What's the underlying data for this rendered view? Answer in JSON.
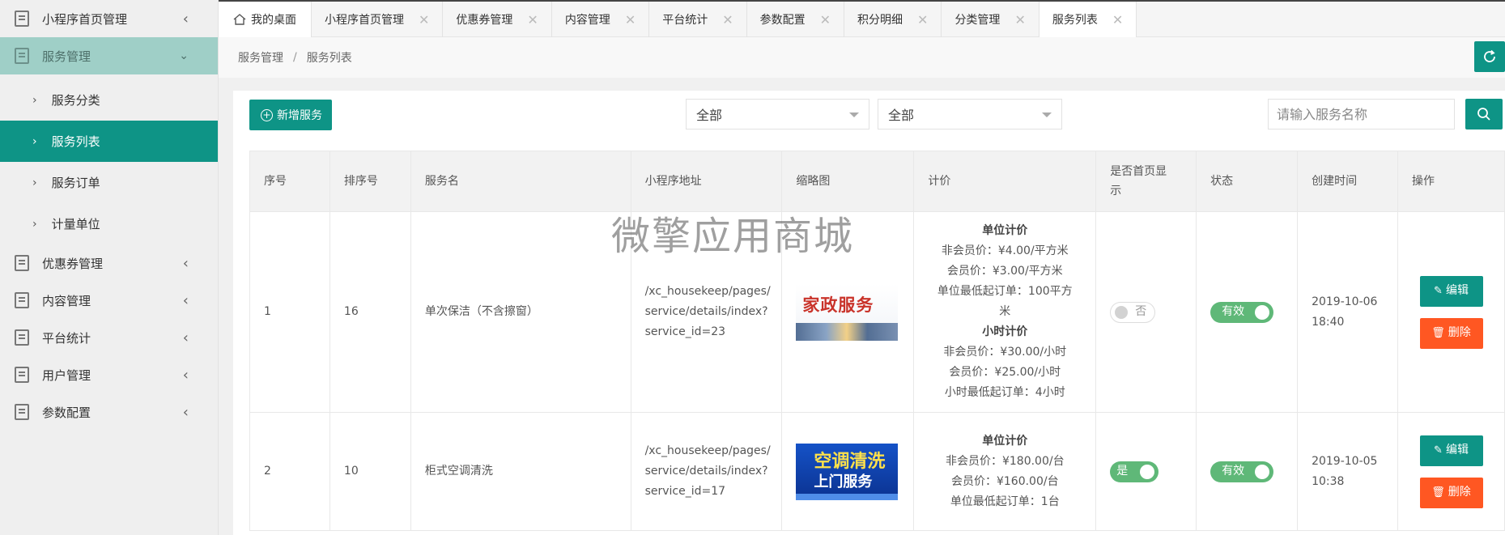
{
  "sidebar": {
    "items": [
      {
        "label": "小程序首页管理",
        "expanded": false
      },
      {
        "label": "服务管理",
        "expanded": true,
        "children": [
          {
            "label": "服务分类"
          },
          {
            "label": "服务列表",
            "active": true
          },
          {
            "label": "服务订单"
          },
          {
            "label": "计量单位"
          }
        ]
      },
      {
        "label": "优惠券管理",
        "expanded": false
      },
      {
        "label": "内容管理",
        "expanded": false
      },
      {
        "label": "平台统计",
        "expanded": false
      },
      {
        "label": "用户管理",
        "expanded": false
      },
      {
        "label": "参数配置",
        "expanded": false
      }
    ]
  },
  "tabs": [
    {
      "label": "我的桌面",
      "home": true
    },
    {
      "label": "小程序首页管理",
      "close": "✕"
    },
    {
      "label": "优惠券管理",
      "close": "✕"
    },
    {
      "label": "内容管理",
      "close": "✕"
    },
    {
      "label": "平台统计",
      "close": "✕"
    },
    {
      "label": "参数配置",
      "close": "✕"
    },
    {
      "label": "积分明细",
      "close": "✕"
    },
    {
      "label": "分类管理",
      "close": "✕"
    },
    {
      "label": "服务列表",
      "close": "✕",
      "active": true
    }
  ],
  "breadcrumb": {
    "parent": "服务管理",
    "sep": "/",
    "current": "服务列表"
  },
  "toolbar": {
    "add_label": "新增服务",
    "select1": "全部",
    "select2": "全部",
    "search_placeholder": "请输入服务名称"
  },
  "table": {
    "headers": {
      "index": "序号",
      "sort": "排序号",
      "name": "服务名",
      "path": "小程序地址",
      "thumb": "缩略图",
      "price": "计价",
      "home": "是否首页显示",
      "status": "状态",
      "created": "创建时间",
      "ops": "操作"
    },
    "rows": [
      {
        "index": "1",
        "sort": "16",
        "name": "单次保洁（不含擦窗）",
        "path": "/xc_housekeep/pages/service/details/index?service_id=23",
        "thumb_text": "家政服务",
        "price_lines": [
          {
            "text": "单位计价",
            "bold": true
          },
          {
            "text": "非会员价：¥4.00/平方米"
          },
          {
            "text": "会员价：¥3.00/平方米"
          },
          {
            "text": "单位最低起订单：100平方"
          },
          {
            "text": "米"
          },
          {
            "text": "小时计价",
            "bold": true
          },
          {
            "text": "非会员价：¥30.00/小时"
          },
          {
            "text": "会员价：¥25.00/小时"
          },
          {
            "text": "小时最低起订单：4小时"
          }
        ],
        "home_label": "否",
        "home_on": false,
        "status_label": "有效",
        "created_date": "2019-10-06",
        "created_time": "18:40",
        "edit_label": "编辑",
        "delete_label": "删除"
      },
      {
        "index": "2",
        "sort": "10",
        "name": "柜式空调清洗",
        "path": "/xc_housekeep/pages/service/details/index?service_id=17",
        "thumb_text_1": "空调清洗",
        "thumb_text_2": "上门服务",
        "price_lines": [
          {
            "text": "单位计价",
            "bold": true
          },
          {
            "text": "非会员价：¥180.00/台"
          },
          {
            "text": "会员价：¥160.00/台"
          },
          {
            "text": "单位最低起订单：1台"
          }
        ],
        "home_label": "是",
        "home_on": true,
        "status_label": "有效",
        "created_date": "2019-10-05",
        "created_time": "10:38",
        "edit_label": "编辑",
        "delete_label": "删除"
      }
    ]
  },
  "watermark": "微擎应用商城",
  "colors": {
    "primary": "#0e9486",
    "danger": "#ff5722",
    "switch_on": "#5fb878",
    "sidebar_group_active": "#9fcfc7"
  }
}
